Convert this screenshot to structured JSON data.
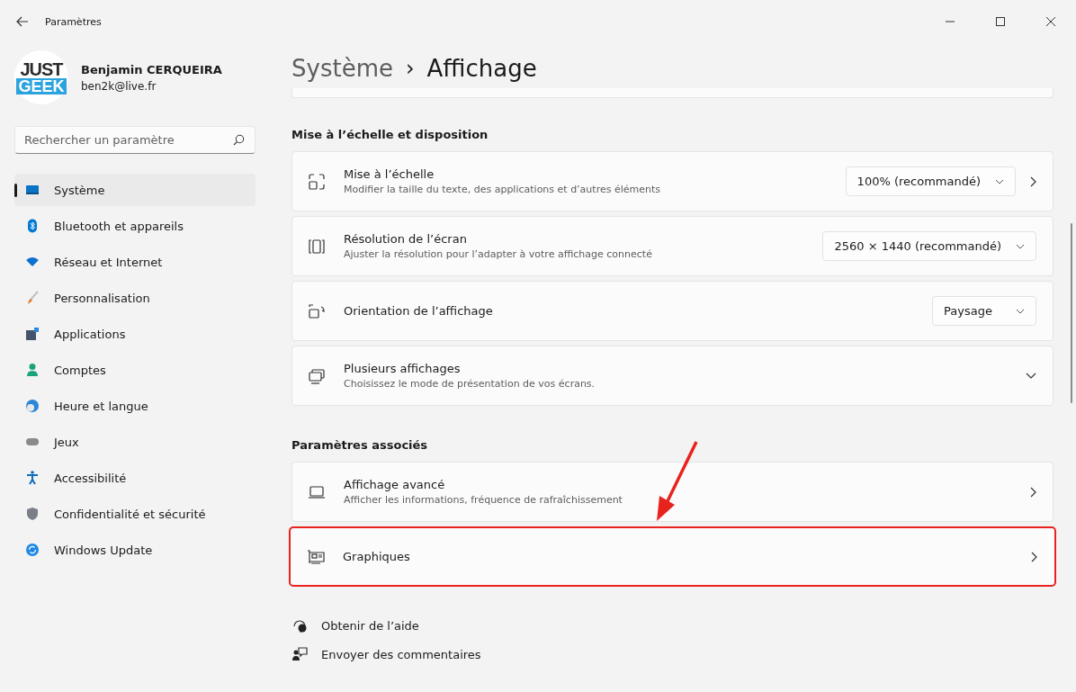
{
  "window": {
    "title": "Paramètres"
  },
  "profile": {
    "avatar_text": [
      "JUST",
      "GEEK"
    ],
    "name": "Benjamin CERQUEIRA",
    "email": "ben2k@live.fr"
  },
  "search": {
    "placeholder": "Rechercher un paramètre"
  },
  "sidebar": {
    "items": [
      {
        "label": "Système",
        "selected": true
      },
      {
        "label": "Bluetooth et appareils",
        "selected": false
      },
      {
        "label": "Réseau et Internet",
        "selected": false
      },
      {
        "label": "Personnalisation",
        "selected": false
      },
      {
        "label": "Applications",
        "selected": false
      },
      {
        "label": "Comptes",
        "selected": false
      },
      {
        "label": "Heure et langue",
        "selected": false
      },
      {
        "label": "Jeux",
        "selected": false
      },
      {
        "label": "Accessibilité",
        "selected": false
      },
      {
        "label": "Confidentialité et sécurité",
        "selected": false
      },
      {
        "label": "Windows Update",
        "selected": false
      }
    ]
  },
  "breadcrumb": {
    "parent": "Système",
    "separator": "›",
    "current": "Affichage"
  },
  "sections": [
    {
      "title": "Mise à l’échelle et disposition",
      "rows": [
        {
          "kind": "dropdown_link",
          "title": "Mise à l’échelle",
          "subtitle": "Modifier la taille du texte, des applications et d’autres éléments",
          "value": "100% (recommandé)",
          "highlighted": false
        },
        {
          "kind": "dropdown",
          "title": "Résolution de l’écran",
          "subtitle": "Ajuster  la résolution pour l’adapter à votre  affichage connecté",
          "value": "2560 × 1440 (recommandé)",
          "highlighted": false
        },
        {
          "kind": "dropdown",
          "title": "Orientation de l’affichage",
          "value": "Paysage",
          "highlighted": false
        },
        {
          "kind": "expander",
          "title": "Plusieurs affichages",
          "subtitle": "Choisissez le mode de présentation de vos écrans.",
          "highlighted": false
        }
      ]
    },
    {
      "title": "Paramètres associés",
      "rows": [
        {
          "kind": "link",
          "title": "Affichage avancé",
          "subtitle": "Afficher les informations, fréquence de rafraîchissement",
          "highlighted": false
        },
        {
          "kind": "link",
          "title": "Graphiques",
          "highlighted": true
        }
      ]
    }
  ],
  "footer_links": [
    "Obtenir de l’aide",
    "Envoyer des commentaires"
  ]
}
